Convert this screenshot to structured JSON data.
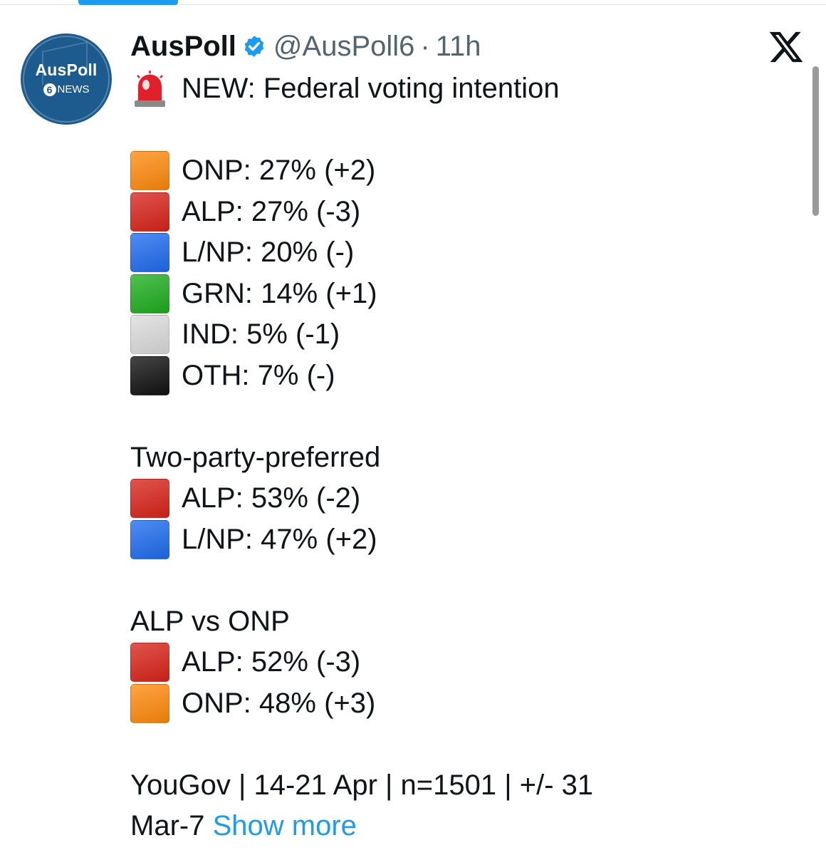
{
  "author": {
    "name": "AusPoll",
    "handle": "@AusPoll6",
    "separator": "·",
    "time": "11h",
    "avatar_title": "AusPoll",
    "avatar_badge": "6",
    "avatar_sub": "NEWS",
    "verified_icon": "verified-badge-icon"
  },
  "post": {
    "headline": "NEW: Federal voting intention",
    "headline_icon": "siren-icon",
    "primary": [
      {
        "text": "ONP: 27% (+2)",
        "color": "#ff8a0d"
      },
      {
        "text": "ALP: 27% (-3)",
        "color": "#d9241a"
      },
      {
        "text": "L/NP: 20% (-)",
        "color": "#1e6cf0"
      },
      {
        "text": "GRN: 14% (+1)",
        "color": "#1fae1f"
      },
      {
        "text": "IND: 5% (-1)",
        "color": "#dcdcdc"
      },
      {
        "text": "OTH: 7% (-)",
        "color": "#111111"
      }
    ],
    "tpp_heading": "Two-party-preferred",
    "tpp": [
      {
        "text": "ALP: 53% (-2)",
        "color": "#d9241a"
      },
      {
        "text": "L/NP: 47% (+2)",
        "color": "#1e6cf0"
      }
    ],
    "vs_heading": "ALP vs ONP",
    "vs": [
      {
        "text": "ALP: 52% (-3)",
        "color": "#d9241a"
      },
      {
        "text": "ONP: 48% (+3)",
        "color": "#ff8a0d"
      }
    ],
    "footer_line1": "YouGov | 14-21 Apr | n=1501 | +/- 31",
    "footer_line2": "Mar-7",
    "show_more": "Show more"
  },
  "colors": {
    "accent": "#1d9bf0",
    "muted_text": "#536471",
    "avatar_bg": "#1d5b8f"
  }
}
